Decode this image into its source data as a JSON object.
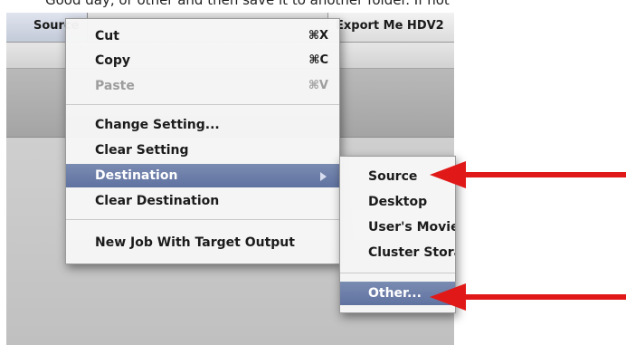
{
  "document_text": "Good day, or other and then save it to another folder. If not",
  "tabs": {
    "source_label": "Source",
    "export_label": "Export Me HDV2"
  },
  "context_menu": {
    "items": [
      {
        "label": "Cut",
        "shortcut": "⌘X"
      },
      {
        "label": "Copy",
        "shortcut": "⌘C"
      },
      {
        "label": "Paste",
        "shortcut": "⌘V",
        "disabled": true
      },
      {
        "label": "Change Setting..."
      },
      {
        "label": "Clear Setting"
      },
      {
        "label": "Destination",
        "has_submenu": true,
        "highlighted": true
      },
      {
        "label": "Clear Destination"
      },
      {
        "label": "New Job With Target Output"
      }
    ]
  },
  "destination_submenu": {
    "items": [
      {
        "label": "Source"
      },
      {
        "label": "Desktop"
      },
      {
        "label": "User's Movies"
      },
      {
        "label": "Cluster Storage"
      },
      {
        "label": "Other...",
        "highlighted": true
      }
    ]
  },
  "colors": {
    "highlight": "#6a7caa",
    "annotation_arrow": "#e01818"
  },
  "annotations": [
    "red-arrow-to-source",
    "red-arrow-to-other"
  ]
}
